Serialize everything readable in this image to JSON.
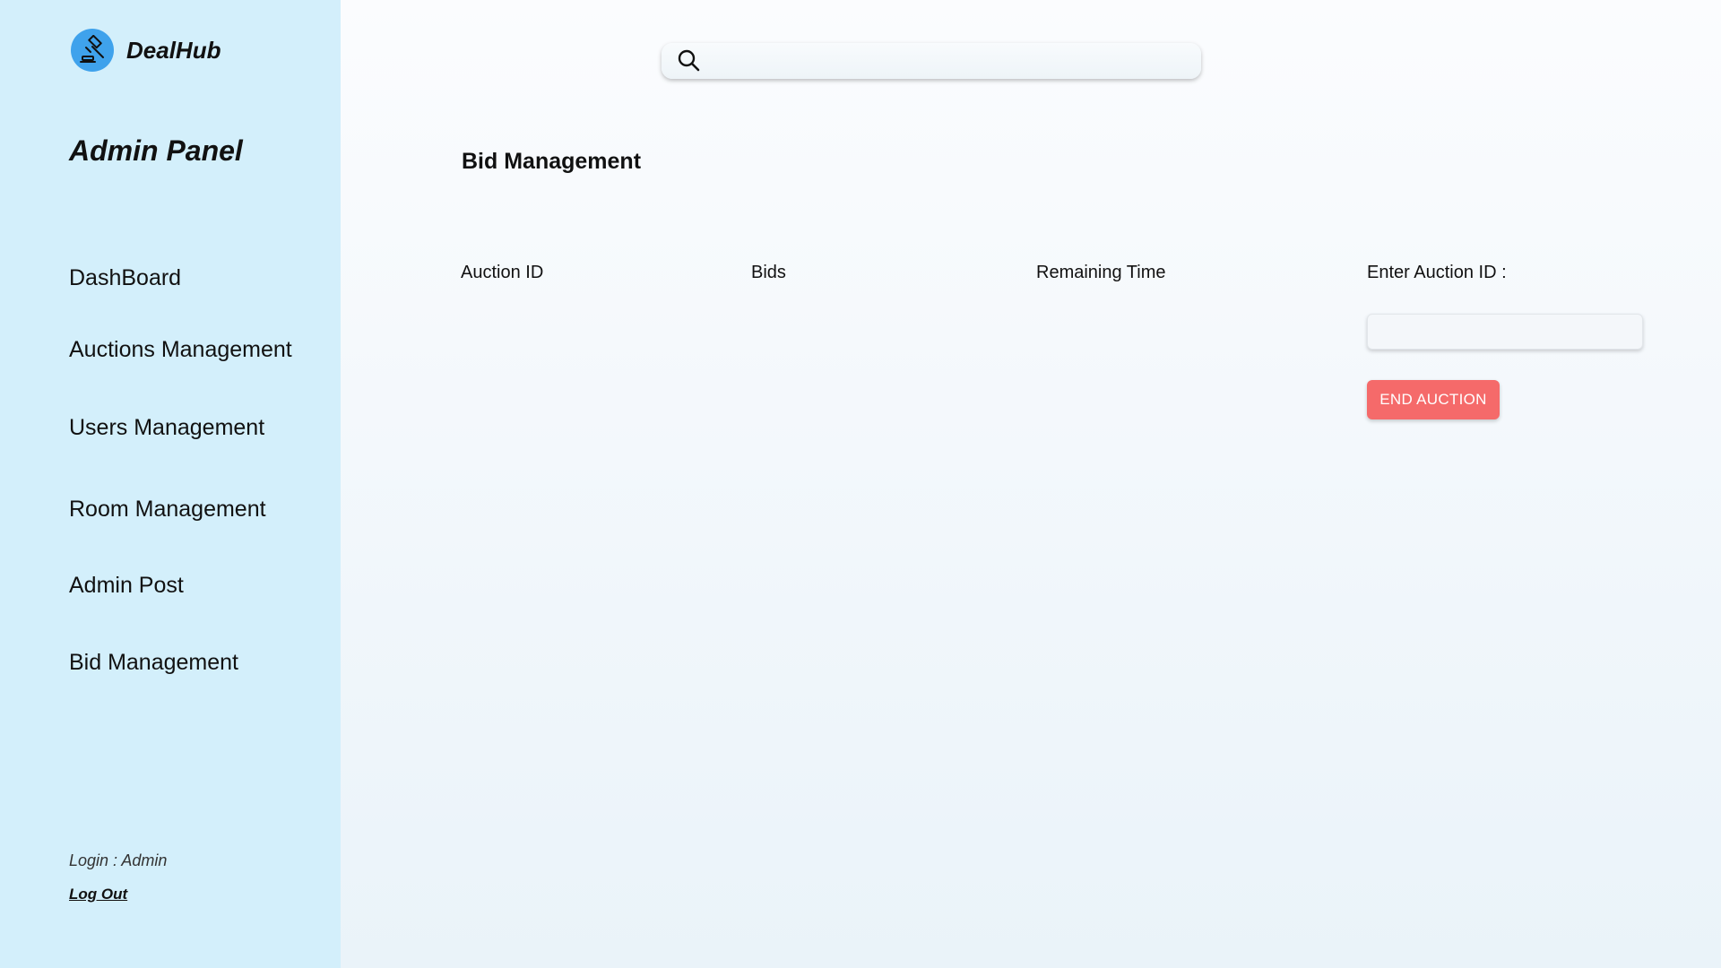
{
  "app": {
    "brand_name": "DealHub",
    "brand_icon": "gavel-icon",
    "accent_color": "#3fa2ec",
    "sidebar_color": "#d3effb"
  },
  "sidebar": {
    "panel_title": "Admin Panel",
    "items": [
      {
        "label": "DashBoard"
      },
      {
        "label": "Auctions Management"
      },
      {
        "label": "Users Management"
      },
      {
        "label": "Room Management"
      },
      {
        "label": "Admin Post"
      },
      {
        "label": "Bid Management"
      }
    ],
    "login_info": "Login : Admin",
    "logout_label": "Log Out"
  },
  "search": {
    "icon": "search-icon",
    "value": "",
    "placeholder": ""
  },
  "main": {
    "page_title": "Bid Management",
    "table": {
      "columns": [
        "Auction ID",
        "Bids",
        "Remaining Time"
      ],
      "rows": []
    },
    "auction_id_label": "Enter Auction ID :",
    "auction_id_value": "",
    "end_button_label": "END AUCTION",
    "end_button_color": "#f56a6a"
  }
}
